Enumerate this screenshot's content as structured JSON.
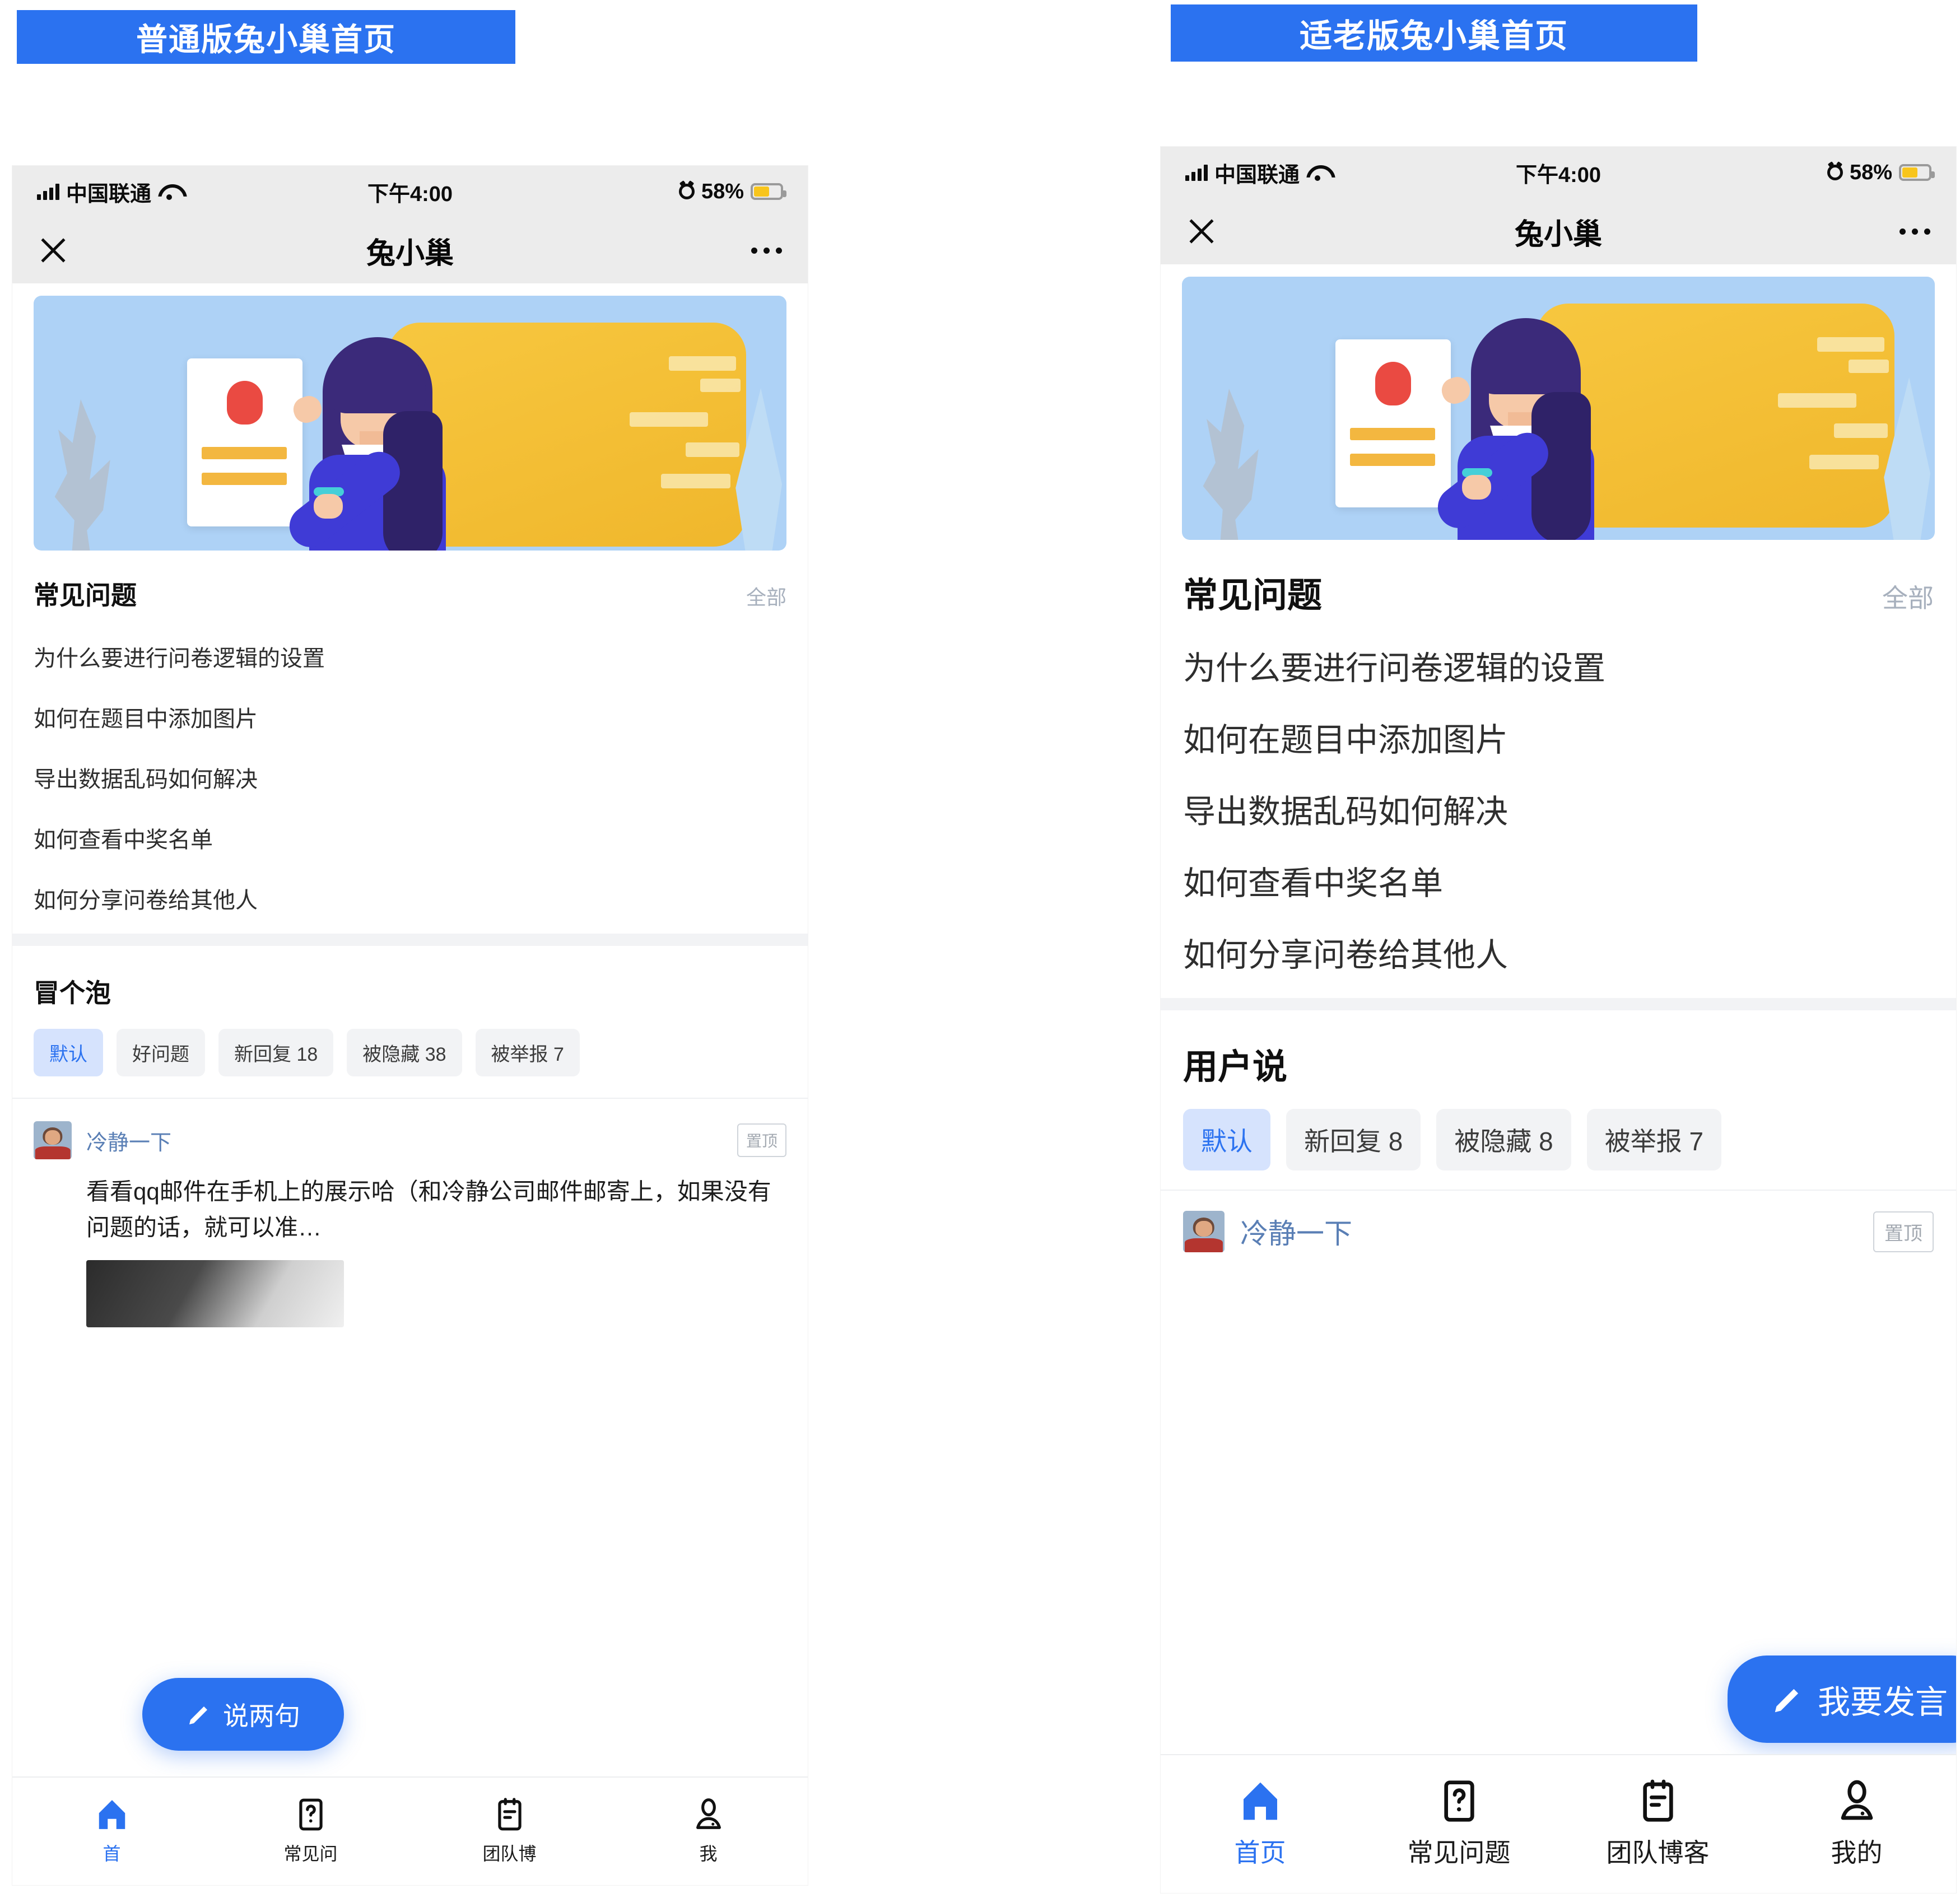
{
  "captions": {
    "left": "普通版兔小巢首页",
    "right": "适老版兔小巢首页"
  },
  "theme": {
    "accent": "#2b72f0",
    "chip_active_bg": "#d6e3fd",
    "chip_bg": "#f2f3f5",
    "statusbar_bg": "#ececec",
    "battery_fill": "#f8c51c"
  },
  "statusbar": {
    "carrier": "中国联通",
    "time": "下午4:00",
    "battery": "58%",
    "icons": {
      "signal": "signal-bars-icon",
      "wifi": "wifi-icon",
      "alarm": "alarm-clock-icon",
      "battery": "battery-icon"
    }
  },
  "navbar": {
    "title": "兔小巢",
    "close_icon": "close-icon",
    "more_icon": "more-dots-icon"
  },
  "left_phone": {
    "faq": {
      "title": "常见问题",
      "all_label": "全部",
      "items": [
        "为什么要进行问卷逻辑的设置",
        "如何在题目中添加图片",
        "导出数据乱码如何解决",
        "如何查看中奖名单",
        "如何分享问卷给其他人"
      ]
    },
    "feed": {
      "title": "冒个泡",
      "chips": [
        {
          "label": "默认",
          "active": true
        },
        {
          "label": "好问题",
          "active": false
        },
        {
          "label": "新回复 18",
          "active": false
        },
        {
          "label": "被隐藏 38",
          "active": false
        },
        {
          "label": "被举报 7",
          "active": false
        }
      ],
      "post": {
        "author": "冷静一下",
        "pin_badge": "置顶",
        "text": "看看qq邮件在手机上的展示哈（和冷静公司邮件邮寄上，如果没有问题的话，就可以准…"
      }
    },
    "fab": {
      "label": "说两句",
      "icon": "pencil-icon"
    },
    "tabs": [
      {
        "label": "首",
        "icon": "home-icon",
        "active": true
      },
      {
        "label": "常见问",
        "icon": "question-icon",
        "active": false
      },
      {
        "label": "团队博",
        "icon": "blog-icon",
        "active": false
      },
      {
        "label": "我",
        "icon": "person-icon",
        "active": false
      }
    ]
  },
  "right_phone": {
    "faq": {
      "title": "常见问题",
      "all_label": "全部",
      "items": [
        "为什么要进行问卷逻辑的设置",
        "如何在题目中添加图片",
        "导出数据乱码如何解决",
        "如何查看中奖名单",
        "如何分享问卷给其他人"
      ]
    },
    "feed": {
      "title": "用户说",
      "chips": [
        {
          "label": "默认",
          "active": true
        },
        {
          "label": "新回复 8",
          "active": false
        },
        {
          "label": "被隐藏 8",
          "active": false
        },
        {
          "label": "被举报 7",
          "active": false
        }
      ],
      "post": {
        "author": "冷静一下",
        "pin_badge": "置顶"
      }
    },
    "fab": {
      "label": "我要发言",
      "icon": "pencil-icon"
    },
    "tabs": [
      {
        "label": "首页",
        "icon": "home-icon",
        "active": true
      },
      {
        "label": "常见问题",
        "icon": "question-icon",
        "active": false
      },
      {
        "label": "团队博客",
        "icon": "blog-icon",
        "active": false
      },
      {
        "label": "我的",
        "icon": "person-icon",
        "active": false
      }
    ]
  }
}
